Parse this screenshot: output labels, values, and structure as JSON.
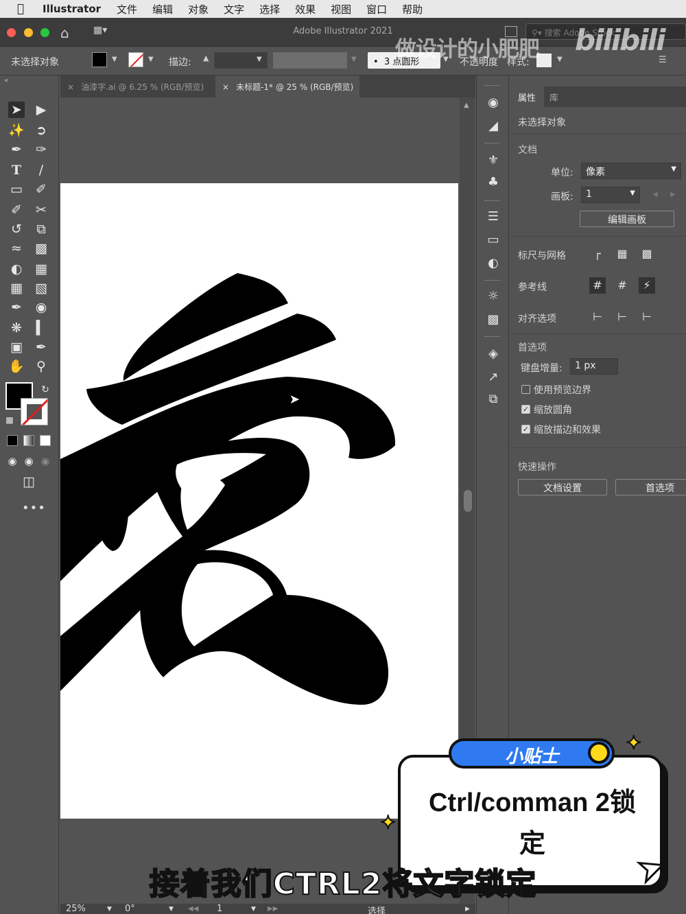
{
  "menubar": {
    "app": "Illustrator",
    "items": [
      "文件",
      "编辑",
      "对象",
      "文字",
      "选择",
      "效果",
      "视图",
      "窗口",
      "帮助"
    ]
  },
  "titlebar": {
    "title": "Adobe Illustrator 2021",
    "search_placeholder": "搜索 Adobe Stock"
  },
  "controlbar": {
    "selection_label": "未选择对象",
    "stroke_label": "描边:",
    "brush": "3 点圆形",
    "opacity_label": "不透明度",
    "style_label": "样式:"
  },
  "tabs": [
    {
      "label": "油漆字.ai @ 6.25 % (RGB/预览)",
      "active": false
    },
    {
      "label": "未标题-1* @ 25 % (RGB/预览)",
      "active": true
    }
  ],
  "properties": {
    "tabs": [
      "属性",
      "库"
    ],
    "selection": "未选择对象",
    "document_section": "文档",
    "units_label": "单位:",
    "units_value": "像素",
    "artboard_label": "画板:",
    "artboard_value": "1",
    "edit_artboard_button": "编辑画板",
    "rulers_grids": "标尺与网格",
    "guides": "参考线",
    "snap_options": "对齐选项",
    "preferences_section": "首选项",
    "keyboard_increment_label": "键盘增量:",
    "keyboard_increment_value": "1 px",
    "use_preview_bounds": {
      "label": "使用预览边界",
      "checked": false
    },
    "scale_corners": {
      "label": "缩放圆角",
      "checked": true
    },
    "scale_strokes": {
      "label": "缩放描边和效果",
      "checked": true
    },
    "quick_actions": "快速操作",
    "doc_setup_button": "文档设置",
    "preferences_button": "首选项"
  },
  "statusbar": {
    "zoom": "25%",
    "rotation": "0°",
    "artboard": "1",
    "mode": "选择"
  },
  "overlay": {
    "watermark": "做设计的小肥肥",
    "bilibili": "bilibili",
    "tip_title": "小贴士",
    "tip_line1": "Ctrl/comman 2锁",
    "tip_line2": "定",
    "subtitle": "接着我们CTRL2将文字锁定"
  },
  "colors": {
    "accent_blue": "#2f7af0",
    "accent_yellow": "#ffd91a",
    "ui_bg": "#535353"
  }
}
